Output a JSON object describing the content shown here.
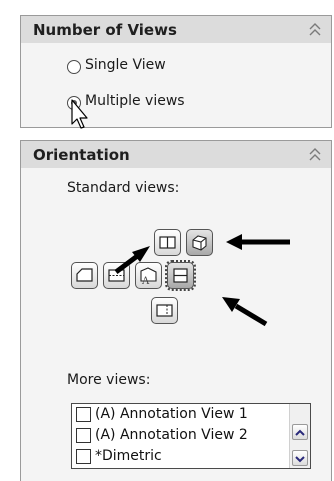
{
  "number_of_views": {
    "title": "Number of Views",
    "options": [
      {
        "label": "Single View",
        "selected": false
      },
      {
        "label": "Multiple views",
        "selected": true
      }
    ]
  },
  "orientation": {
    "title": "Orientation",
    "standard_views_label": "Standard views:",
    "standard_view_buttons": [
      "front-view",
      "isometric-view",
      "left-view",
      "top-view",
      "current-model-view",
      "right-view",
      "bottom-view"
    ],
    "selected_view": "right-view",
    "more_views_label": "More views:",
    "more_views": [
      {
        "label": "(A) Annotation View 1",
        "checked": false
      },
      {
        "label": "(A) Annotation View 2",
        "checked": false
      },
      {
        "label": "*Dimetric",
        "checked": false
      }
    ]
  },
  "icons": [
    "collapse-icon",
    "mouse-pointer-icon",
    "scroll-up-icon",
    "scroll-down-icon"
  ]
}
